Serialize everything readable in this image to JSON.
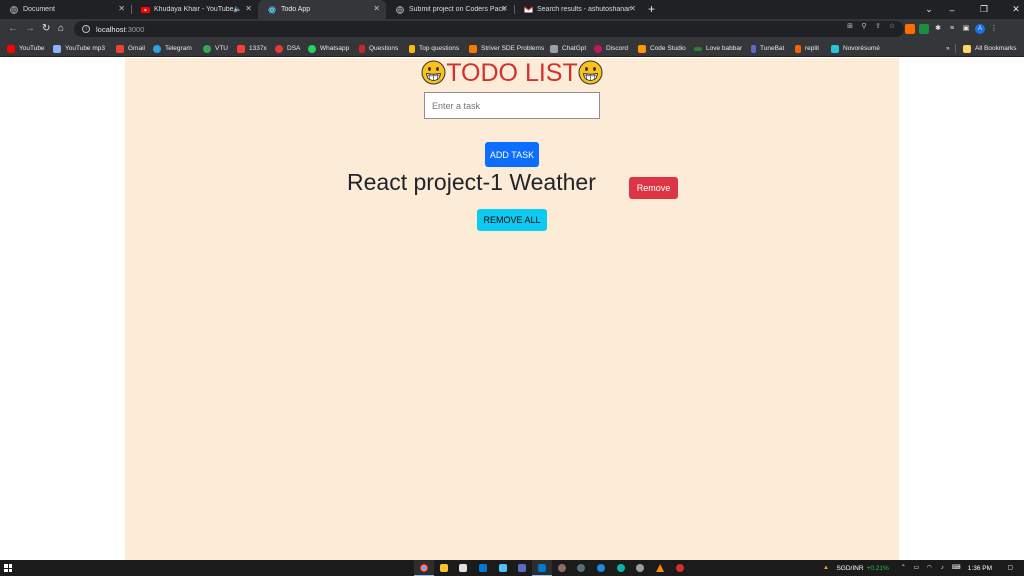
{
  "browser": {
    "tabs": [
      {
        "title": "Document",
        "active": false
      },
      {
        "title": "Khudaya Khair - YouTube",
        "active": false
      },
      {
        "title": "Todo App",
        "active": true
      },
      {
        "title": "Submit project on Coders Packet",
        "active": false
      },
      {
        "title": "Search results - ashutoshanand",
        "active": false
      }
    ],
    "address": {
      "host": "localhost",
      "port": ":3000"
    },
    "bookmarks": [
      "YouTube",
      "YouTube mp3",
      "Gmail",
      "Telegram",
      "VTU",
      "1337x",
      "DSA",
      "Whatsapp",
      "Questions",
      "Top questions",
      "Striver SDE Problems",
      "ChatGpt",
      "Discord",
      "Code Studio",
      "Love babbar",
      "TuneBat",
      "replit",
      "Novorésumé"
    ],
    "all_bookmarks": "All Bookmarks",
    "profile_initial": "A"
  },
  "app": {
    "title": "TODO LIST",
    "input_placeholder": "Enter a task",
    "add_label": "ADD TASK",
    "tasks": [
      {
        "text": "React project-1 Weather",
        "remove_label": "Remove"
      }
    ],
    "remove_all_label": "REMOVE ALL"
  },
  "taskbar": {
    "ticker_pair": "SGD/INR",
    "ticker_change": "+0.21%",
    "clock": "1:36 PM"
  },
  "colors": {
    "app_background": "#fbebd7",
    "title": "#d0332f",
    "add_button": "#0d6efd",
    "remove_button": "#dc3545",
    "remove_all_button": "#0dcaf0"
  }
}
